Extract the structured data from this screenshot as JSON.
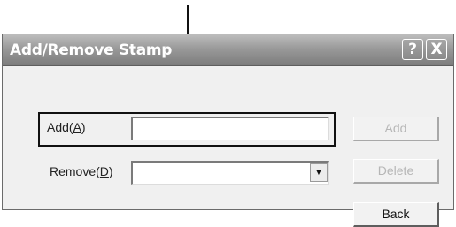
{
  "dialog": {
    "title": "Add/Remove Stamp",
    "help_glyph": "?",
    "close_glyph": "X"
  },
  "add": {
    "label_prefix": "Add(",
    "label_key": "A",
    "label_suffix": ")",
    "value": "",
    "button_label": "Add",
    "button_enabled": false
  },
  "remove": {
    "label_prefix": "Remove(",
    "label_key": "D",
    "label_suffix": ")",
    "selected_value": "",
    "dropdown_icon": "chevron-down-icon",
    "button_label": "Delete",
    "button_enabled": false
  },
  "back": {
    "button_label": "Back"
  }
}
